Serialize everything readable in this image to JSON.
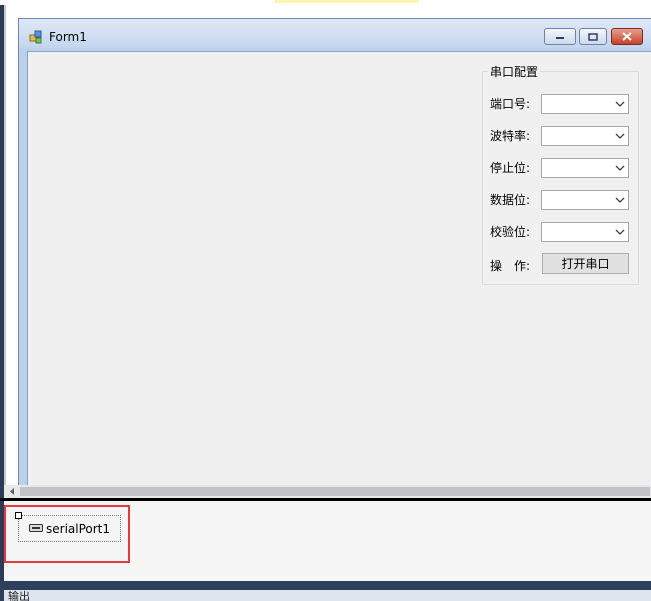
{
  "form": {
    "title": "Form1"
  },
  "group": {
    "title": "串口配置",
    "fields": [
      {
        "label": "端口号:",
        "value": ""
      },
      {
        "label": "波特率:",
        "value": ""
      },
      {
        "label": "停止位:",
        "value": ""
      },
      {
        "label": "数据位:",
        "value": ""
      },
      {
        "label": "校验位:",
        "value": ""
      }
    ],
    "action_label": "操　作:",
    "open_button": "打开串口"
  },
  "tray": {
    "component_label": "serialPort1"
  },
  "panel": {
    "output_label": "输出"
  },
  "colors": {
    "highlight": "#e33b3b",
    "title_gradient_top": "#dfe9f6",
    "client_bg": "#f0f0f0"
  }
}
